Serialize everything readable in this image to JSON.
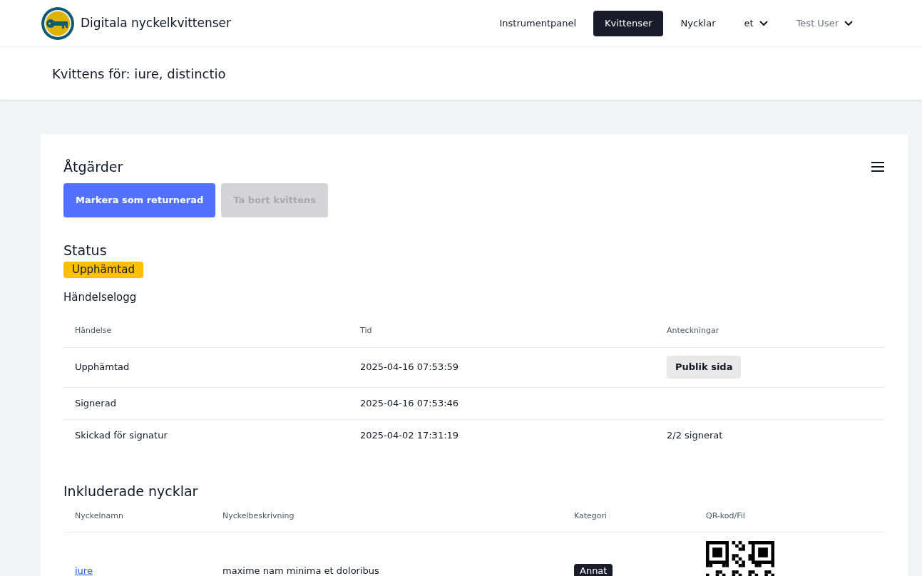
{
  "header": {
    "app_name": "Digitala nyckelkvittenser",
    "nav": [
      {
        "label": "Instrumentpanel",
        "selected": false,
        "kind": "link"
      },
      {
        "label": "Kvittenser",
        "selected": true,
        "kind": "link"
      },
      {
        "label": "Nycklar",
        "selected": false,
        "kind": "link"
      },
      {
        "label": "et",
        "selected": false,
        "kind": "dropdown"
      },
      {
        "label": "Test User",
        "selected": false,
        "kind": "user"
      }
    ]
  },
  "page_title": "Kvittens för: iure, distinctio",
  "actions": {
    "title": "Åtgärder",
    "buttons": [
      {
        "label": "Markera som returnerad",
        "disabled": false
      },
      {
        "label": "Ta bort kvittens",
        "disabled": true
      }
    ]
  },
  "status": {
    "title": "Status",
    "badge": "Upphämtad"
  },
  "event_log": {
    "title": "Händelselogg",
    "columns": [
      "Händelse",
      "Tid",
      "Anteckningar"
    ],
    "rows": [
      {
        "event": "Upphämtad",
        "time": "2025-04-16 07:53:59",
        "note": {
          "kind": "button",
          "text": "Publik sida"
        }
      },
      {
        "event": "Signerad",
        "time": "2025-04-16 07:53:46"
      },
      {
        "event": "Skickad för signatur",
        "time": "2025-04-02 17:31:19",
        "note": {
          "kind": "text",
          "text": "2/2 signerat"
        }
      }
    ]
  },
  "keys": {
    "title": "Inkluderade nycklar",
    "columns": [
      "Nyckelnamn",
      "Nyckelbeskrivning",
      "Kategori",
      "QR-kod/Fil"
    ],
    "rows": [
      {
        "name": "iure",
        "description": "maxime nam minima et doloribus",
        "category": "Annat"
      }
    ]
  }
}
